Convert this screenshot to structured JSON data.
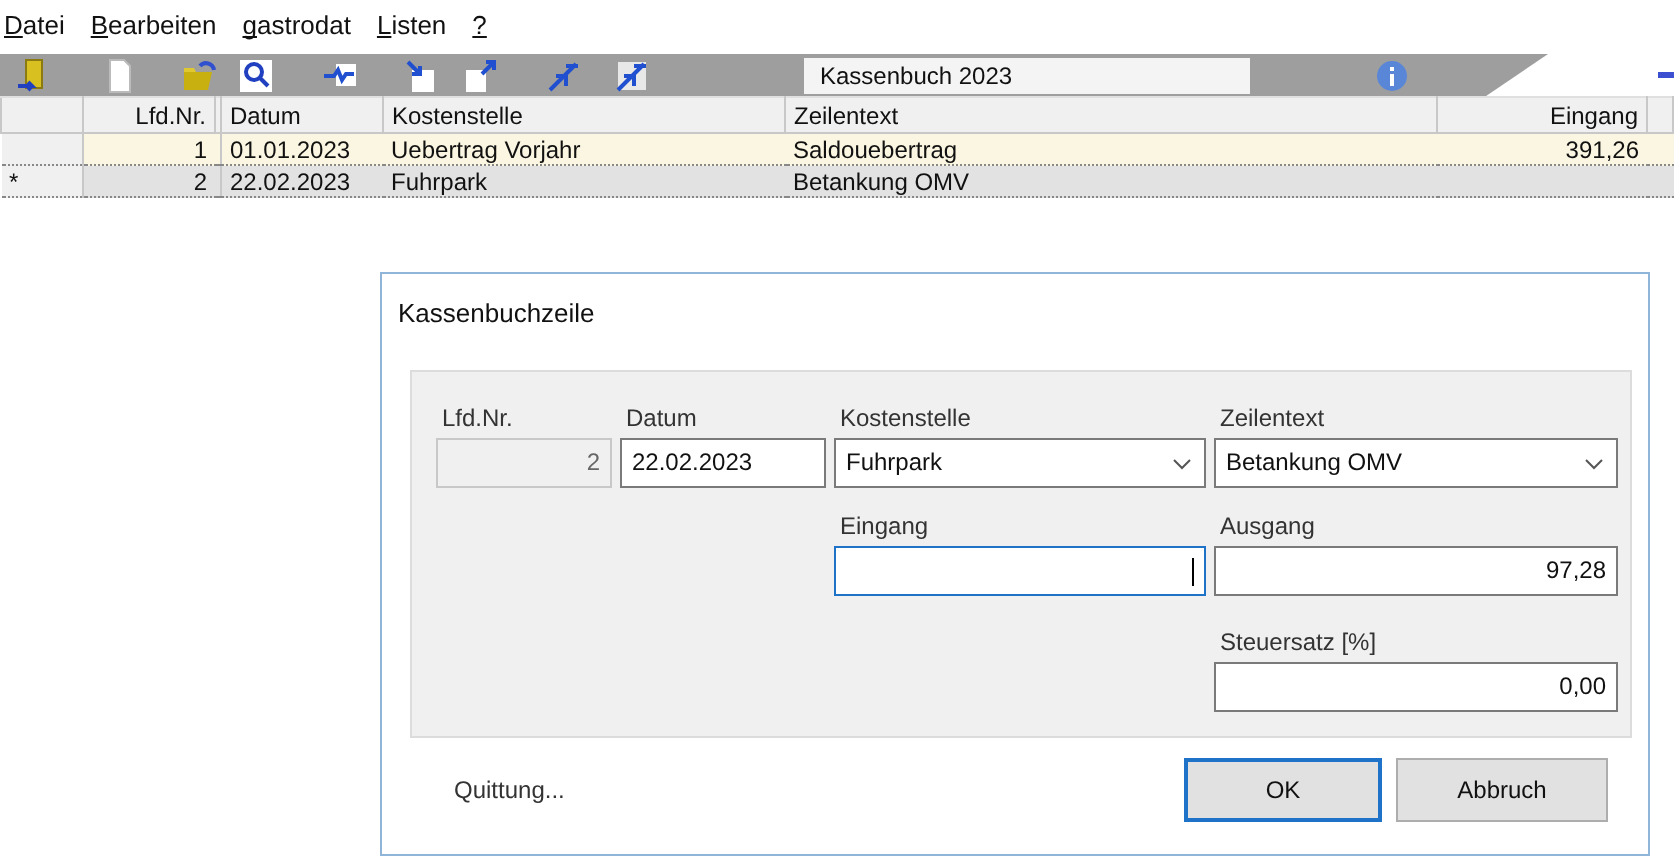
{
  "menu": [
    {
      "label": "Datei",
      "mnemonic": true
    },
    {
      "label": "Bearbeiten",
      "mnemonic": true
    },
    {
      "label": "gastrodat",
      "mnemonic": true
    },
    {
      "label": "Listen",
      "mnemonic": true
    },
    {
      "label": "?",
      "mnemonic": true
    }
  ],
  "toolbar": {
    "title_field": "Kassenbuch 2023"
  },
  "table": {
    "columns": [
      "Lfd.Nr.",
      "",
      "Datum",
      "Kostenstelle",
      "Zeilentext",
      "Eingang"
    ],
    "rows": [
      {
        "selected": true,
        "cells": [
          "1",
          "",
          "01.01.2023",
          "Uebertrag Vorjahr",
          "Saldouebertrag",
          "391,26"
        ]
      },
      {
        "selected": false,
        "marker": "*",
        "cells": [
          "2",
          "",
          "22.02.2023",
          "Fuhrpark",
          "Betankung OMV",
          ""
        ]
      }
    ]
  },
  "dialog": {
    "title": "Kassenbuchzeile",
    "fields": [
      {
        "label": "Lfd.Nr.",
        "value": "2",
        "kind": "number",
        "disabled": true,
        "focused": false
      },
      {
        "label": "Datum",
        "value": "22.02.2023",
        "kind": "text",
        "disabled": false,
        "focused": false
      },
      {
        "label": "Kostenstelle",
        "value": "Fuhrpark",
        "kind": "combo",
        "disabled": false,
        "focused": false
      },
      {
        "label": "Zeilentext",
        "value": "Betankung OMV",
        "kind": "combo",
        "disabled": false,
        "focused": false
      },
      {
        "label": "Eingang",
        "kind": "number",
        "disabled": false,
        "focused": true
      },
      {
        "label": "Ausgang",
        "value": "97,28",
        "kind": "number",
        "disabled": false,
        "focused": false
      },
      {
        "label": "Steuersatz [%]",
        "value": "0,00",
        "kind": "number",
        "disabled": false,
        "focused": false
      }
    ],
    "link": "Quittung...",
    "buttons": [
      {
        "label": "OK",
        "default": true
      },
      {
        "label": "Abbruch",
        "default": false
      }
    ]
  }
}
